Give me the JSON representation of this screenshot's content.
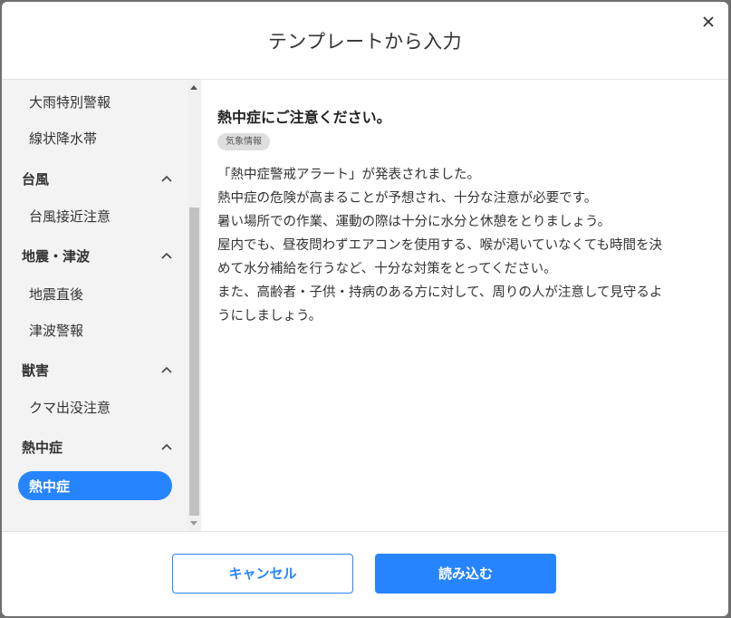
{
  "dialog": {
    "title": "テンプレートから入力"
  },
  "sidebar": {
    "items_top": [
      {
        "label": "大雨特別警報"
      },
      {
        "label": "線状降水帯"
      }
    ],
    "groups": [
      {
        "label": "台風",
        "items": [
          "台風接近注意"
        ]
      },
      {
        "label": "地震・津波",
        "items": [
          "地震直後",
          "津波警報"
        ]
      },
      {
        "label": "獣害",
        "items": [
          "クマ出没注意"
        ]
      },
      {
        "label": "熱中症",
        "items": [
          "熱中症"
        ]
      }
    ],
    "active_item": "熱中症"
  },
  "content": {
    "title": "熱中症にご注意ください。",
    "tag": "気象情報",
    "lines": [
      "「熱中症警戒アラート」が発表されました。",
      "熱中症の危険が高まることが予想され、十分な注意が必要です。",
      "暑い場所での作業、運動の際は十分に水分と休憩をとりましょう。",
      "屋内でも、昼夜問わずエアコンを使用する、喉が渇いていなくても時間を決",
      "めて水分補給を行うなど、十分な対策をとってください。",
      "また、高齢者・子供・持病のある方に対して、周りの人が注意して見守るよ",
      "うにしましょう。"
    ]
  },
  "footer": {
    "cancel_label": "キャンセル",
    "load_label": "読み込む"
  },
  "colors": {
    "accent": "#2684ff",
    "sidebar_bg": "#f3f3f3",
    "tag_bg": "#dedede"
  }
}
